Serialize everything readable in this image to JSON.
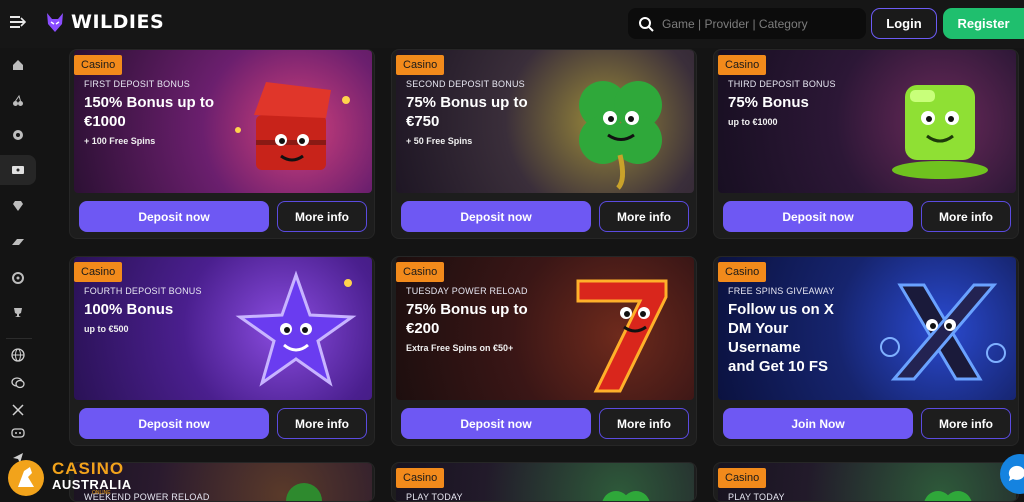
{
  "header": {
    "brand": "WILDIES",
    "search_placeholder": "Game | Provider | Category",
    "login_label": "Login",
    "register_label": "Register"
  },
  "sidebar": {
    "items": [
      "home-icon",
      "cherries-icon",
      "chip-icon",
      "ticket-icon",
      "diamond-icon",
      "bonus-icon",
      "wheel-icon",
      "trophy-icon",
      "globe-icon",
      "chat-icon",
      "x-icon",
      "discord-icon",
      "telegram-icon"
    ]
  },
  "cards": [
    {
      "badge": "Casino",
      "kicker": "FIRST DEPOSIT BONUS",
      "headline": "150% Bonus up to\n€1000",
      "sub": "+ 100 Free Spins",
      "primary": "Deposit now",
      "secondary": "More info",
      "bg": "#3b1742"
    },
    {
      "badge": "Casino",
      "kicker": "SECOND DEPOSIT BONUS",
      "headline": "75% Bonus up to\n€750",
      "sub": "+ 50 Free Spins",
      "primary": "Deposit now",
      "secondary": "More info",
      "bg": "#2a1f2e"
    },
    {
      "badge": "Casino",
      "kicker": "THIRD DEPOSIT BONUS",
      "headline": "75% Bonus",
      "sub": "up to €1000",
      "primary": "Deposit now",
      "secondary": "More info",
      "bg": "#22152e"
    },
    {
      "badge": "Casino",
      "kicker": "FOURTH DEPOSIT BONUS",
      "headline": "100% Bonus",
      "sub": "up to €500",
      "primary": "Deposit now",
      "secondary": "More info",
      "bg": "#3a1a6e"
    },
    {
      "badge": "Casino",
      "kicker": "TUESDAY POWER RELOAD",
      "headline": "75% Bonus up to\n€200",
      "sub": "Extra Free Spins on €50+",
      "primary": "Deposit now",
      "secondary": "More info",
      "bg": "#2a1212"
    },
    {
      "badge": "Casino",
      "kicker": "FREE SPINS GIVEAWAY",
      "headline": "Follow us on X\nDM Your\nUsername\nand Get 10 FS",
      "sub": "",
      "primary": "Join Now",
      "secondary": "More info",
      "bg": "#0e1a4a"
    }
  ],
  "partial_cards": [
    {
      "badge": "",
      "kicker": "WEEKEND POWER RELOAD"
    },
    {
      "badge": "Casino",
      "kicker": "PLAY TODAY"
    },
    {
      "badge": "Casino",
      "kicker": "PLAY TODAY"
    }
  ],
  "watermark": {
    "line1": "CASINO",
    "line2": "AUSTRALIA",
    "tag": "ONLINE"
  },
  "colors": {
    "accent": "#6e58f3",
    "register": "#1fbf6e",
    "badge": "#f28a1b"
  }
}
